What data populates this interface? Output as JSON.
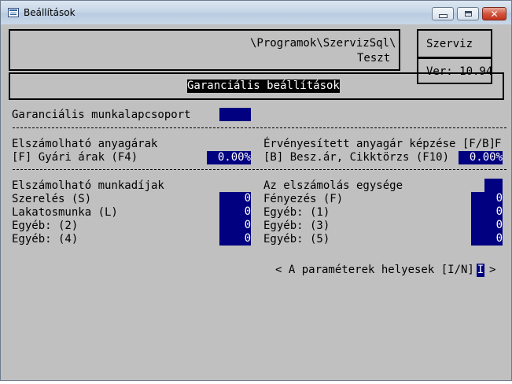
{
  "window": {
    "title": "Beállítások",
    "icon": "app-window-icon",
    "buttons": {
      "minimize": "minimize-icon",
      "maximize": "maximize-icon",
      "close": "close-icon"
    }
  },
  "header": {
    "path": "\\Programok\\SzervizSql\\",
    "company": "Teszt",
    "app_name": "Szerviz",
    "version": "Ver: 10.94",
    "screen_title": "Garanciális beállítások"
  },
  "group": {
    "label": "Garanciális munkalapcsoport",
    "value": ""
  },
  "materials": {
    "left_title": "Elszámolható anyagárak",
    "left_option": "[F] Gyári árak (F4)",
    "left_value": "0.00%",
    "right_title": "Érvényesített anyagár képzése [F/B]",
    "right_mode": "F",
    "right_option": "[B] Besz.ár, Cikktörzs (F10)",
    "right_value": "0.00%"
  },
  "labor": {
    "left_title": "Elszámolható munkadíjak",
    "right_title": "Az elszámolás egysége",
    "unit_value": "",
    "left_items": [
      {
        "label": "Szerelés (S)",
        "value": "0"
      },
      {
        "label": "Lakatosmunka (L)",
        "value": "0"
      },
      {
        "label": "Egyéb: (2)",
        "value": "0"
      },
      {
        "label": "Egyéb: (4)",
        "value": "0"
      }
    ],
    "right_items": [
      {
        "label": "Fényezés (F)",
        "value": "0"
      },
      {
        "label": "Egyéb: (1)",
        "value": "0"
      },
      {
        "label": "Egyéb: (3)",
        "value": "0"
      },
      {
        "label": "Egyéb: (5)",
        "value": "0"
      }
    ]
  },
  "confirm": {
    "prefix": "< A paraméterek helyesek [I/N]:",
    "value": "I",
    "suffix": ">"
  },
  "colors": {
    "field_bg": "#000080",
    "window_bg": "#c0c0c0",
    "close_button": "#c3331e"
  }
}
